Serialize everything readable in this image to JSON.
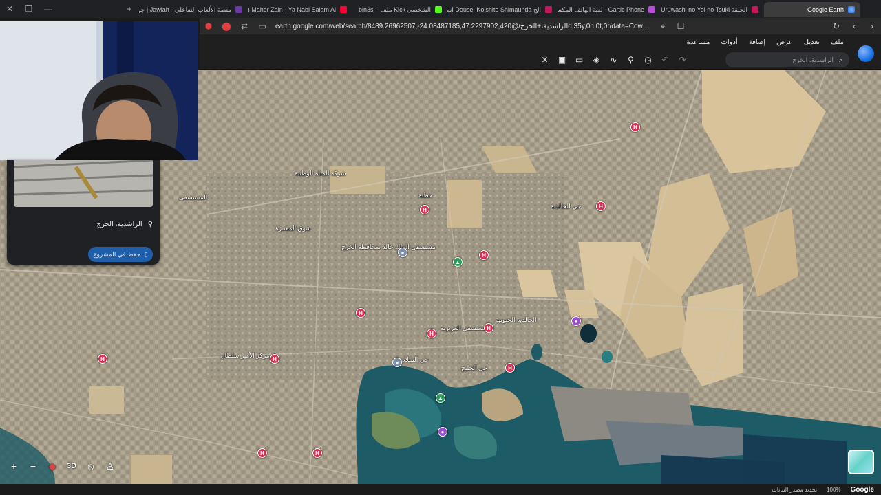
{
  "browser": {
    "tabs": [
      {
        "title": "Google Earth",
        "active": true,
        "icon": "google-earth-favicon"
      },
      {
        "title": "انمي Uruwashi no Yoi no Tsuki الحلقة",
        "icon": "anime-favicon"
      },
      {
        "title": "لعبة الهاتف المكسور - Gartic Phone",
        "icon": "gartic-favicon"
      },
      {
        "title": "انمي Douse, Koishite Shimaunda الح",
        "icon": "anime-favicon"
      },
      {
        "title": "bin3sl - ملف Kick الشخصي",
        "icon": "kick-favicon"
      },
      {
        "title": "(734) Maher Zain - Ya Nabi Salam Al",
        "icon": "youtube-favicon"
      },
      {
        "title": "جولة | Jawlah - منصة الألعاب التفاعلي",
        "icon": "jawlah-favicon"
      }
    ],
    "new_tab": "+",
    "url": "earth.google.com/web/search/الراشدية،+الخرج/@24.08487185,47.2297902,420-,8489.26962507d,35y,0h,0t,0r/data=CowBGl4SWAoIMHgzZTI1N"
  },
  "app": {
    "menu": [
      "ملف",
      "تعديل",
      "عرض",
      "إضافة",
      "أدوات",
      "مساعدة"
    ],
    "search_placeholder": "الراشدية، الخرج",
    "toolbar_icons": [
      "rocket-off-icon",
      "images-icon",
      "ruler-icon",
      "layers-icon",
      "path-icon",
      "placemark-icon",
      "history-icon",
      "undo-icon",
      "redo-icon"
    ]
  },
  "map": {
    "labels": [
      {
        "text": "شركة المياه الوطنية"
      },
      {
        "text": "حطبة"
      },
      {
        "text": "حي الخالدية"
      },
      {
        "text": "المستشفى"
      },
      {
        "text": "مستشفى الملك خالد بمحافظة الخرج"
      },
      {
        "text": "سوق المقيبرة"
      },
      {
        "text": "الخالدية الجنوبية"
      },
      {
        "text": "مستشفى العزيزية"
      },
      {
        "text": "مركز الأمير سلطان"
      },
      {
        "text": "حي السلام"
      },
      {
        "text": "حي الخليج"
      }
    ]
  },
  "place_panel": {
    "place_name": "الراشدية، الخرج",
    "save_button": "حفظ في المشروع"
  },
  "controls": {
    "zoom_in": "+",
    "zoom_out": "−",
    "mode_3d": "3D"
  },
  "status": {
    "data_attribution": "تحديد مصدر البيانات",
    "zoom_level": "100%",
    "brand": "Google"
  },
  "colors": {
    "accent": "#1a73e8",
    "hospital_pin": "#d93055",
    "park_pin": "#2e9d5b",
    "purple_pin": "#9c4dd0",
    "water": "#1d5b66"
  }
}
